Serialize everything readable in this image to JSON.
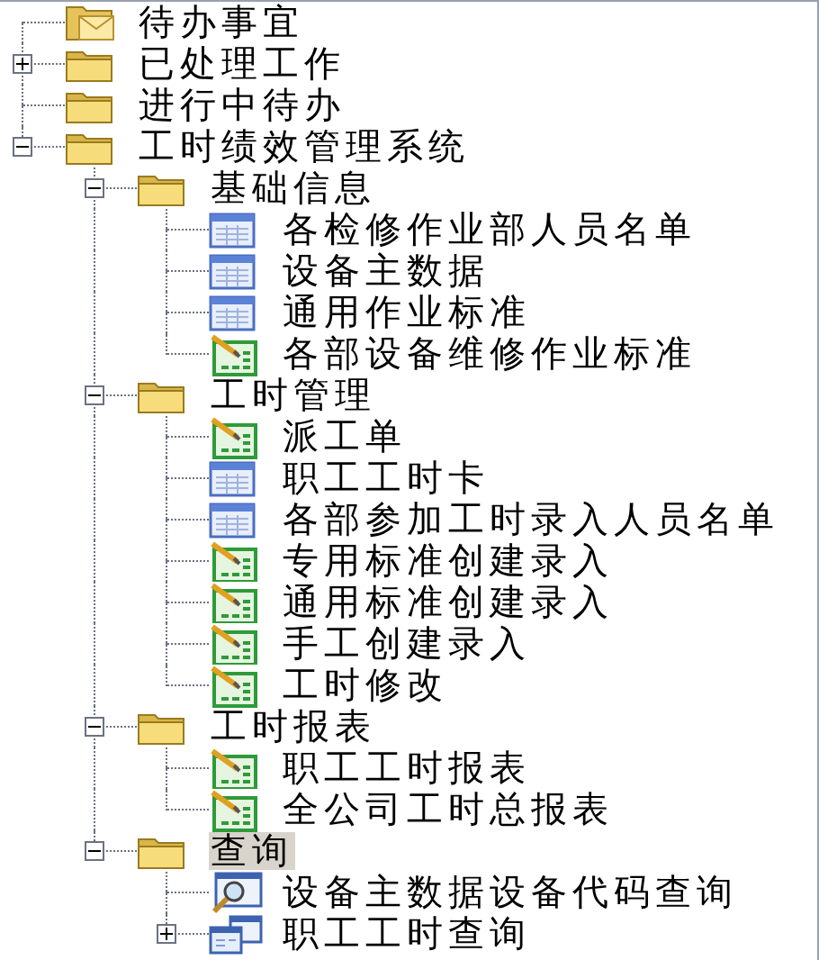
{
  "tree": [
    {
      "label": "待办事宜",
      "kind": "mail",
      "selected": false
    },
    {
      "label": "已处理工作",
      "kind": "folder",
      "expanded": false,
      "selected": false
    },
    {
      "label": "进行中待办",
      "kind": "folder",
      "selected": false
    },
    {
      "label": "工时绩效管理系统",
      "kind": "folder",
      "expanded": true,
      "selected": false,
      "children": [
        {
          "label": "基础信息",
          "kind": "folder",
          "expanded": true,
          "selected": false,
          "children": [
            {
              "label": "各检修作业部人员名单",
              "kind": "grid",
              "selected": false
            },
            {
              "label": "设备主数据",
              "kind": "grid",
              "selected": false
            },
            {
              "label": "通用作业标准",
              "kind": "grid",
              "selected": false
            },
            {
              "label": "各部设备维修作业标准",
              "kind": "edit",
              "selected": false
            }
          ]
        },
        {
          "label": "工时管理",
          "kind": "folder",
          "expanded": true,
          "selected": false,
          "children": [
            {
              "label": "派工单",
              "kind": "edit",
              "selected": false
            },
            {
              "label": "职工工时卡",
              "kind": "grid",
              "selected": false
            },
            {
              "label": "各部参加工时录入人员名单",
              "kind": "grid",
              "selected": false
            },
            {
              "label": "专用标准创建录入",
              "kind": "edit",
              "selected": false
            },
            {
              "label": "通用标准创建录入",
              "kind": "edit",
              "selected": false
            },
            {
              "label": "手工创建录入",
              "kind": "edit",
              "selected": false
            },
            {
              "label": "工时修改",
              "kind": "edit",
              "selected": false
            }
          ]
        },
        {
          "label": "工时报表",
          "kind": "folder",
          "expanded": true,
          "selected": false,
          "children": [
            {
              "label": "职工工时报表",
              "kind": "edit",
              "selected": false
            },
            {
              "label": "全公司工时总报表",
              "kind": "edit",
              "selected": false
            }
          ]
        },
        {
          "label": "查询",
          "kind": "folder",
          "expanded": true,
          "selected": true,
          "children": [
            {
              "label": "设备主数据设备代码查询",
              "kind": "search",
              "selected": false
            },
            {
              "label": "职工工时查询",
              "kind": "windows",
              "expanded": false,
              "selected": false
            }
          ]
        }
      ]
    }
  ]
}
